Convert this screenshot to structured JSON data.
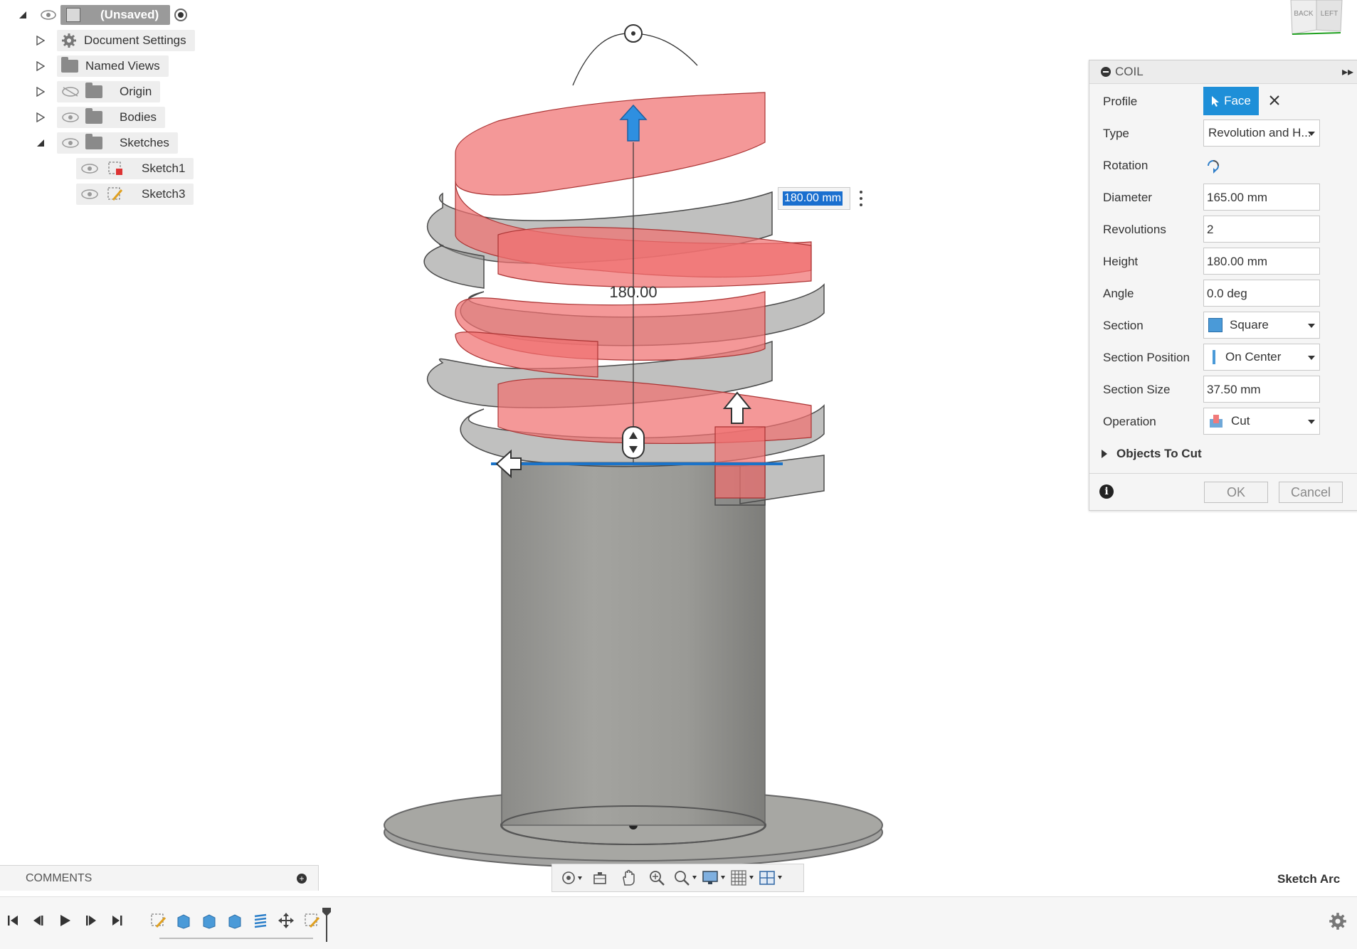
{
  "browser": {
    "root_label": "(Unsaved)",
    "items": [
      {
        "label": "Document Settings"
      },
      {
        "label": "Named Views"
      },
      {
        "label": "Origin"
      },
      {
        "label": "Bodies"
      },
      {
        "label": "Sketches"
      },
      {
        "label": "Sketch1"
      },
      {
        "label": "Sketch3"
      }
    ]
  },
  "viewport": {
    "dimension_input_value": "180.00 mm",
    "dimension_label": "180.00",
    "viewcube_faces": [
      "BACK",
      "LEFT"
    ],
    "colors": {
      "cut_preview": "#f07070",
      "body": "#8f8f8f",
      "selection": "#1a73c9",
      "arrow_active": "#2e8fe0"
    }
  },
  "coil_dialog": {
    "title": "COIL",
    "rows": {
      "profile": {
        "label": "Profile",
        "value": "Face"
      },
      "type": {
        "label": "Type",
        "value": "Revolution and H..."
      },
      "rotation": {
        "label": "Rotation"
      },
      "diameter": {
        "label": "Diameter",
        "value": "165.00 mm"
      },
      "revolutions": {
        "label": "Revolutions",
        "value": "2"
      },
      "height": {
        "label": "Height",
        "value": "180.00 mm"
      },
      "angle": {
        "label": "Angle",
        "value": "0.0 deg"
      },
      "section": {
        "label": "Section",
        "value": "Square"
      },
      "section_position": {
        "label": "Section Position",
        "value": "On Center"
      },
      "section_size": {
        "label": "Section Size",
        "value": "37.50 mm"
      },
      "operation": {
        "label": "Operation",
        "value": "Cut"
      }
    },
    "objects_to_cut": "Objects To Cut",
    "ok_label": "OK",
    "cancel_label": "Cancel",
    "accent_color": "#1e8fd8"
  },
  "comments": {
    "label": "COMMENTS"
  },
  "status": {
    "hint": "Sketch Arc"
  }
}
